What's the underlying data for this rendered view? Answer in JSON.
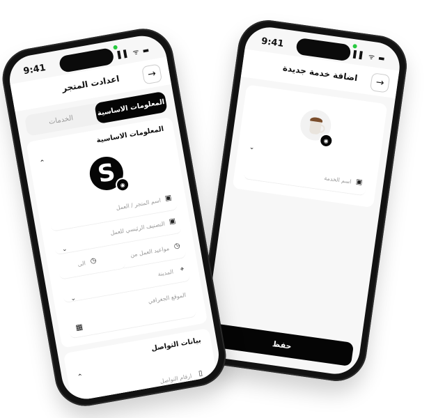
{
  "left_phone": {
    "time": "9:41",
    "status": "▌▌ ᯤ ▬",
    "title": "اعدادت المتجر",
    "back_icon": "arrow-right-icon",
    "tabs": [
      {
        "label": "المعلومات الاساسية",
        "active": true
      },
      {
        "label": "الخدمات",
        "active": false
      }
    ],
    "basic_section_title": "المعلومات الاساسية",
    "logo_letter": "S",
    "fields": {
      "store_name": "اسم المتجر / العمل",
      "main_category": "التصنيف الرئيسي للعمل",
      "hours_from": "مواعيد العمل من",
      "hours_to": "الى",
      "city": "المدينة",
      "location": "الموقع الجغرافي"
    },
    "contact_section_title": "بيانات التواصل",
    "contact_fields": {
      "phone": "ارقام التواصل"
    }
  },
  "right_phone": {
    "time": "9:41",
    "status": "▌▌ ᯤ ▬",
    "title": "اضافة خدمة جديدة",
    "back_icon": "arrow-right-icon",
    "fields": {
      "service_name": "اسم الخدمة"
    },
    "save_label": "حفظ"
  }
}
